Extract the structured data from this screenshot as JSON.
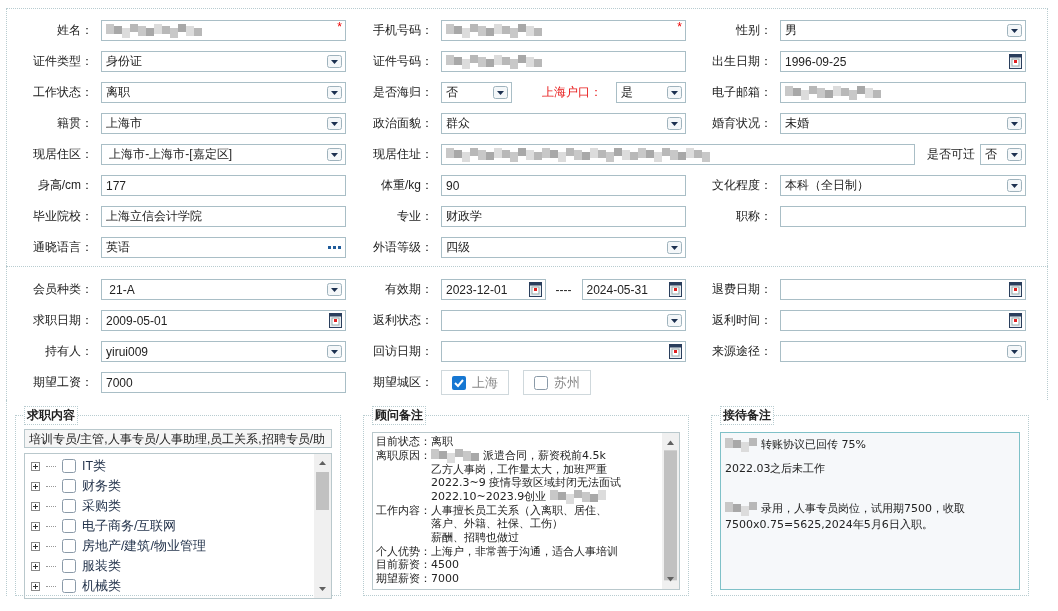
{
  "profile": {
    "rows": [
      {
        "groups": [
          {
            "label": "姓名：",
            "controls": [
              {
                "kind": "text",
                "blurred": true,
                "required_mark": "*"
              }
            ]
          },
          {
            "label": "手机号码：",
            "controls": [
              {
                "kind": "text",
                "blurred": true,
                "required_mark": "*"
              }
            ]
          },
          {
            "label": "性别：",
            "controls": [
              {
                "kind": "select",
                "value": "男"
              }
            ]
          }
        ]
      },
      {
        "groups": [
          {
            "label": "证件类型：",
            "controls": [
              {
                "kind": "select",
                "value": "身份证"
              }
            ]
          },
          {
            "label": "证件号码：",
            "controls": [
              {
                "kind": "text",
                "blurred": true
              }
            ]
          },
          {
            "label": "出生日期：",
            "controls": [
              {
                "kind": "date",
                "value": "1996-09-25"
              }
            ]
          }
        ]
      },
      {
        "groups": [
          {
            "label": "工作状态：",
            "controls": [
              {
                "kind": "select",
                "value": "离职"
              }
            ]
          },
          {
            "label": "是否海归：",
            "controls": [
              {
                "kind": "select",
                "value": "否"
              },
              {
                "kind": "label",
                "text": "上海户口：",
                "emphasis": true
              },
              {
                "kind": "select",
                "value": "是"
              }
            ]
          },
          {
            "label": "电子邮箱：",
            "controls": [
              {
                "kind": "text",
                "blurred": true
              }
            ]
          }
        ]
      },
      {
        "groups": [
          {
            "label": "籍贯：",
            "controls": [
              {
                "kind": "select",
                "value": "上海市"
              }
            ]
          },
          {
            "label": "政治面貌：",
            "controls": [
              {
                "kind": "select",
                "value": "群众"
              }
            ]
          },
          {
            "label": "婚育状况：",
            "controls": [
              {
                "kind": "select",
                "value": "未婚"
              }
            ]
          }
        ]
      },
      {
        "groups": [
          {
            "label": "现居住区：",
            "controls": [
              {
                "kind": "select",
                "value": " 上海市-上海市-[嘉定区]"
              }
            ]
          },
          {
            "label": "现居住址：",
            "kind": "wide",
            "controls": [
              {
                "kind": "text",
                "blurred": true
              },
              {
                "kind": "label",
                "text": "是否可迁",
                "emphasis": false
              },
              {
                "kind": "select",
                "value": "否"
              }
            ]
          }
        ]
      },
      {
        "groups": [
          {
            "label": "身高/cm：",
            "controls": [
              {
                "kind": "text",
                "value": "177"
              }
            ]
          },
          {
            "label": "体重/kg：",
            "controls": [
              {
                "kind": "text",
                "value": "90"
              }
            ]
          },
          {
            "label": "文化程度：",
            "controls": [
              {
                "kind": "select",
                "value": "本科（全日制）"
              }
            ]
          }
        ]
      },
      {
        "groups": [
          {
            "label": "毕业院校：",
            "controls": [
              {
                "kind": "text",
                "value": "上海立信会计学院"
              }
            ]
          },
          {
            "label": "专业：",
            "controls": [
              {
                "kind": "text",
                "value": "财政学"
              }
            ]
          },
          {
            "label": "职称：",
            "controls": [
              {
                "kind": "text"
              }
            ]
          }
        ]
      },
      {
        "groups": [
          {
            "label": "通晓语言：",
            "controls": [
              {
                "kind": "lookup",
                "value": "英语"
              }
            ]
          },
          {
            "label": "外语等级：",
            "controls": [
              {
                "kind": "select",
                "value": "四级"
              }
            ]
          }
        ]
      }
    ]
  },
  "membership": {
    "rows": [
      {
        "groups": [
          {
            "label": "会员种类：",
            "controls": [
              {
                "kind": "select",
                "value": " 21-A"
              }
            ]
          },
          {
            "label": "有效期：",
            "controls": [
              {
                "kind": "date",
                "value": "2023-12-01"
              },
              {
                "kind": "separator",
                "text": "----"
              },
              {
                "kind": "date",
                "value": "2024-05-31"
              }
            ]
          },
          {
            "label": "退费日期：",
            "controls": [
              {
                "kind": "date"
              }
            ]
          }
        ]
      },
      {
        "groups": [
          {
            "label": "求职日期：",
            "controls": [
              {
                "kind": "date",
                "value": "2009-05-01"
              }
            ]
          },
          {
            "label": "返利状态：",
            "controls": [
              {
                "kind": "select"
              }
            ]
          },
          {
            "label": "返利时间：",
            "controls": [
              {
                "kind": "date"
              }
            ]
          }
        ]
      },
      {
        "groups": [
          {
            "label": "持有人：",
            "controls": [
              {
                "kind": "select",
                "value": "yirui009"
              }
            ]
          },
          {
            "label": "回访日期：",
            "controls": [
              {
                "kind": "date"
              }
            ]
          },
          {
            "label": "来源途径：",
            "controls": [
              {
                "kind": "select"
              }
            ]
          }
        ]
      },
      {
        "groups": [
          {
            "label": "期望工资：",
            "controls": [
              {
                "kind": "text",
                "value": "7000"
              }
            ]
          },
          {
            "label": "期望城区：",
            "controls": [
              {
                "kind": "checkbox",
                "text": "上海",
                "checked": true
              },
              {
                "kind": "checkbox",
                "text": "苏州",
                "checked": false
              }
            ]
          }
        ]
      }
    ]
  },
  "job_intent": {
    "title": "求职内容",
    "summary": "培训专员/主管,人事专员/人事助理,员工关系,招聘专员/助",
    "categories": [
      {
        "label": "IT类",
        "checked": false,
        "expanded": false
      },
      {
        "label": "财务类",
        "checked": false,
        "expanded": false
      },
      {
        "label": "采购类",
        "checked": false,
        "expanded": false
      },
      {
        "label": "电子商务/互联网",
        "checked": false,
        "expanded": false
      },
      {
        "label": "房地产/建筑/物业管理",
        "checked": false,
        "expanded": false
      },
      {
        "label": "服装类",
        "checked": false,
        "expanded": false
      },
      {
        "label": "机械类",
        "checked": false,
        "expanded": false
      }
    ]
  },
  "advisor_notes": {
    "title": "顾问备注",
    "entries": [
      {
        "label": "目前状态：",
        "lines": [
          {
            "text": "离职"
          }
        ]
      },
      {
        "label": "离职原因：",
        "lines": [
          {
            "text": "派遣合同，薪资税前4.5k",
            "blurred_before": true
          },
          {
            "text": "乙方人事岗，工作量太大，加班严重"
          },
          {
            "text": "2022.3~9 疫情导致区域封闭无法面试"
          },
          {
            "text": "2022.10~2023.9创业",
            "blurred_after": true
          }
        ]
      },
      {
        "label": "工作内容：",
        "lines": [
          {
            "text": "人事擅长员工关系（入离职、居住、"
          },
          {
            "text": "落户、外籍、社保、工伤）"
          },
          {
            "text": "薪酬、招聘也做过"
          }
        ]
      },
      {
        "label": "个人优势：",
        "lines": [
          {
            "text": "上海户，非常善于沟通，适合人事培训"
          }
        ]
      },
      {
        "label": "目前薪资：",
        "lines": [
          {
            "text": "4500"
          }
        ]
      },
      {
        "label": "期望薪资：",
        "lines": [
          {
            "text": "7000"
          }
        ]
      }
    ]
  },
  "reception_notes": {
    "title": "接待备注",
    "paragraphs": [
      {
        "lines": [
          {
            "text": "转账协议已回传 75%",
            "blurred_before": true
          }
        ]
      },
      {
        "lines": [
          {
            "text": "2022.03之后未工作"
          }
        ]
      },
      {
        "lines": [
          {
            "text": "录用，人事专员岗位，试用期7500，收取",
            "blurred_before": true
          },
          {
            "text": "7500x0.75=5625,2024年5月6日入职。"
          }
        ]
      }
    ]
  }
}
